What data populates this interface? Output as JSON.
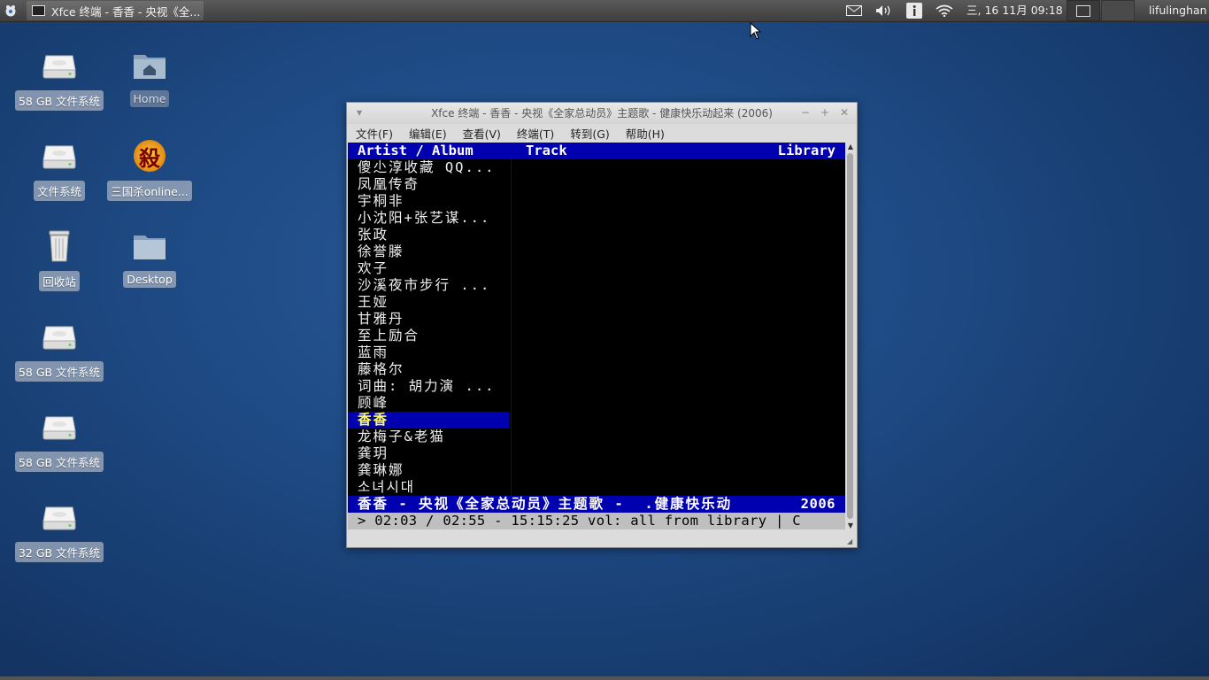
{
  "panel": {
    "task_title": "Xfce 终端 - 香香 - 央视《全...",
    "clock": "三, 16 11月  09:18",
    "user": "lifulinghan",
    "tray_icons": [
      "mail-icon",
      "volume-icon",
      "info-icon",
      "wifi-icon"
    ]
  },
  "desktop": {
    "icons": [
      {
        "label": "58 GB 文件系统",
        "type": "drive"
      },
      {
        "label": "Home",
        "type": "home"
      },
      {
        "label": "文件系统",
        "type": "drive"
      },
      {
        "label": "三国杀online...",
        "type": "app",
        "glyph": "殺"
      },
      {
        "label": "回收站",
        "type": "trash"
      },
      {
        "label": "Desktop",
        "type": "folder"
      },
      {
        "label": "58 GB 文件系统",
        "type": "drive"
      },
      {
        "label": "58 GB 文件系统",
        "type": "drive"
      },
      {
        "label": "32 GB 文件系统",
        "type": "drive"
      }
    ]
  },
  "window": {
    "title": "Xfce 终端 - 香香 - 央视《全家总动员》主题歌 - 健康快乐动起来 (2006)",
    "menu": [
      "文件(F)",
      "编辑(E)",
      "查看(V)",
      "终端(T)",
      "转到(G)",
      "帮助(H)"
    ],
    "terminal": {
      "header": {
        "artist_album": "Artist / Album",
        "track": "Track",
        "library": "Library"
      },
      "artists": [
        "傻尐淳收藏 QQ...",
        "凤凰传奇",
        "宇桐非",
        "小沈阳+张艺谋...",
        "张政",
        "徐誉滕",
        "欢子",
        "沙溪夜市步行 ...",
        "王娅",
        "甘雅丹",
        "至上励合",
        "蓝雨",
        "藤格尔",
        "词曲: 胡力演 ...",
        "顾峰",
        "香香",
        "龙梅子&老猫",
        "龚玥",
        "龚琳娜",
        "소녀시대"
      ],
      "selected_index": 15,
      "now_playing": "香香 - 央视《全家总动员》主题歌 -  .健康快乐动",
      "now_playing_year": "2006",
      "status": "> 02:03 / 02:55 - 15:15:25 vol: all from library | C"
    }
  }
}
